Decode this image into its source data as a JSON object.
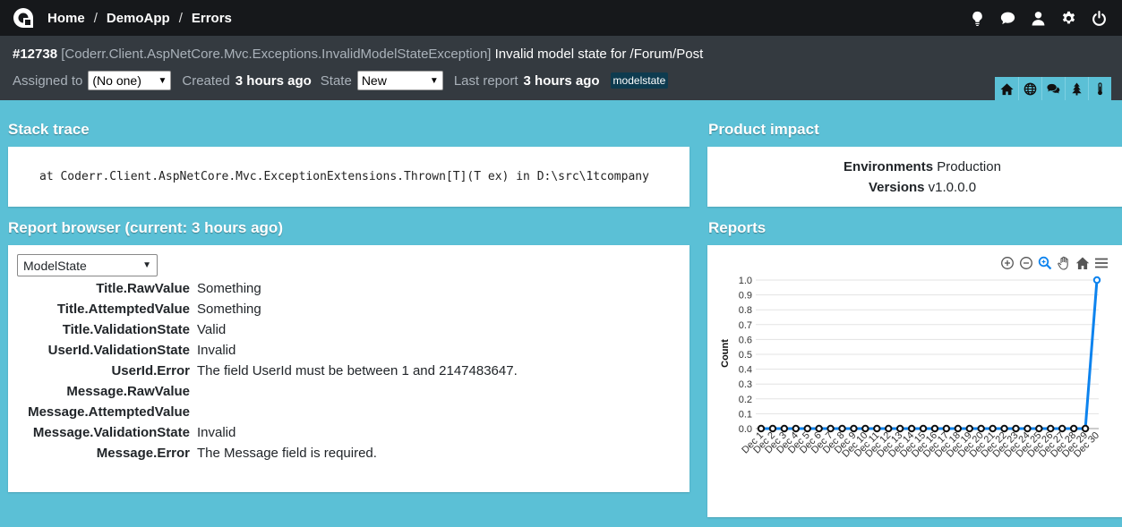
{
  "nav": {
    "breadcrumbs": [
      "Home",
      "DemoApp",
      "Errors"
    ],
    "separator": "/",
    "top_icons": [
      "lightbulb-icon",
      "chat-icon",
      "user-icon",
      "gear-icon",
      "power-icon"
    ]
  },
  "incident": {
    "number": "#12738",
    "exception": "[Coderr.Client.AspNetCore.Mvc.Exceptions.InvalidModelStateException]",
    "message": "Invalid model state for /Forum/Post",
    "assigned_label": "Assigned to",
    "assigned_value": "(No one)",
    "created_label": "Created",
    "created_value": "3 hours ago",
    "state_label": "State",
    "state_value": "New",
    "last_report_label": "Last report",
    "last_report_value": "3 hours ago",
    "tag": "modelstate",
    "tab_icons": [
      "home-icon",
      "globe-icon",
      "comments-icon",
      "tree-icon",
      "thermometer-icon"
    ]
  },
  "stack_trace": {
    "title": "Stack trace",
    "text": "at Coderr.Client.AspNetCore.Mvc.ExceptionExtensions.Thrown[T](T ex) in D:\\src\\1tcompany"
  },
  "product_impact": {
    "title": "Product impact",
    "environments_label": "Environments",
    "environments_value": "Production",
    "versions_label": "Versions",
    "versions_value": "v1.0.0.0"
  },
  "report_browser": {
    "title": "Report browser (current: 3 hours ago)",
    "selected_collection": "ModelState",
    "rows": [
      {
        "key": "Title.RawValue",
        "value": "Something"
      },
      {
        "key": "Title.AttemptedValue",
        "value": "Something"
      },
      {
        "key": "Title.ValidationState",
        "value": "Valid"
      },
      {
        "key": "UserId.ValidationState",
        "value": "Invalid"
      },
      {
        "key": "UserId.Error",
        "value": "The field UserId must be between 1 and 2147483647."
      },
      {
        "key": "Message.RawValue",
        "value": ""
      },
      {
        "key": "Message.AttemptedValue",
        "value": ""
      },
      {
        "key": "Message.ValidationState",
        "value": "Invalid"
      },
      {
        "key": "Message.Error",
        "value": "The Message field is required."
      }
    ]
  },
  "reports": {
    "title": "Reports",
    "toolbar_icons": [
      "zoom-in-icon",
      "zoom-out-icon",
      "zoom-select-icon",
      "pan-icon",
      "reset-home-icon",
      "menu-icon"
    ]
  },
  "chart_data": {
    "type": "line",
    "title": "",
    "xlabel": "",
    "ylabel": "Count",
    "ylim": [
      0,
      1
    ],
    "yticks": [
      "0.0",
      "0.1",
      "0.2",
      "0.3",
      "0.4",
      "0.5",
      "0.6",
      "0.7",
      "0.8",
      "0.9",
      "1.0"
    ],
    "grid": true,
    "categories": [
      "Dec 1",
      "Dec 2",
      "Dec 3",
      "Dec 4",
      "Dec 5",
      "Dec 6",
      "Dec 7",
      "Dec 8",
      "Dec 9",
      "Dec 10",
      "Dec 11",
      "Dec 12",
      "Dec 13",
      "Dec 14",
      "Dec 15",
      "Dec 16",
      "Dec 17",
      "Dec 18",
      "Dec 19",
      "Dec 20",
      "Dec 21",
      "Dec 22",
      "Dec 23",
      "Dec 24",
      "Dec 25",
      "Dec 26",
      "Dec 27",
      "Dec 28",
      "Dec 29",
      "Dec 30"
    ],
    "series": [
      {
        "values": [
          0,
          0,
          0,
          0,
          0,
          0,
          0,
          0,
          0,
          0,
          0,
          0,
          0,
          0,
          0,
          0,
          0,
          0,
          0,
          0,
          0,
          0,
          0,
          0,
          0,
          0,
          0,
          0,
          0,
          1
        ]
      }
    ],
    "line_color": "#0d83ee"
  }
}
